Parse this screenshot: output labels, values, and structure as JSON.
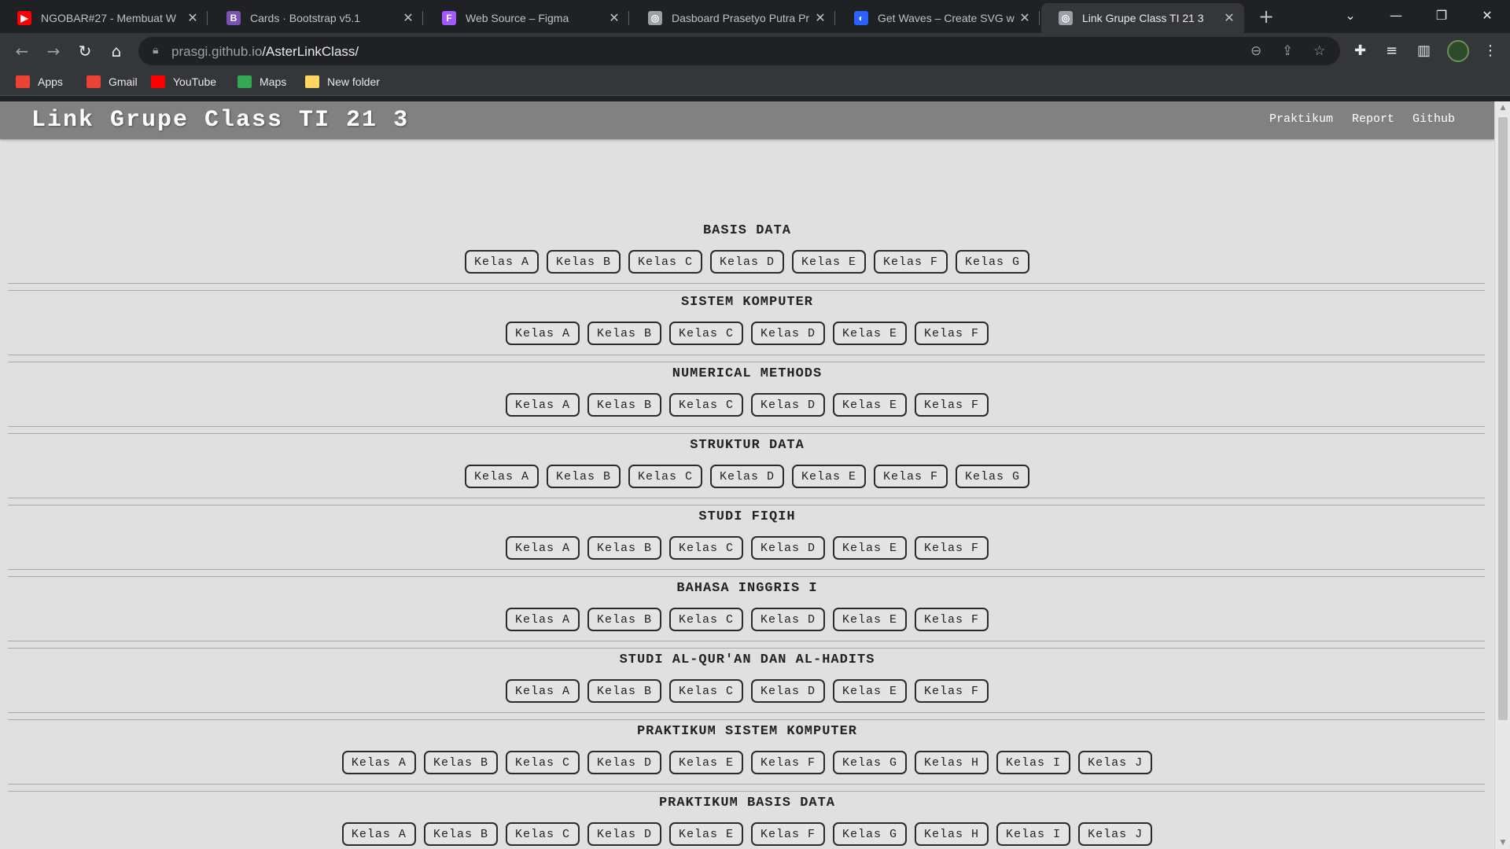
{
  "browser": {
    "tabs": [
      {
        "title": "NGOBAR#27 - Membuat W",
        "favicon": "youtube-icon",
        "color": "#ff0000",
        "glyph": "▶",
        "active": false
      },
      {
        "title": "Cards · Bootstrap v5.1",
        "favicon": "bootstrap-icon",
        "color": "#7952b3",
        "glyph": "B",
        "active": false
      },
      {
        "title": "Web Source – Figma",
        "favicon": "figma-icon",
        "color": "#a259ff",
        "glyph": "F",
        "active": false
      },
      {
        "title": "Dasboard Prasetyo Putra Pr",
        "favicon": "globe-icon",
        "color": "#9aa0a6",
        "glyph": "◎",
        "active": false
      },
      {
        "title": "Get Waves – Create SVG w",
        "favicon": "waves-icon",
        "color": "#2962ff",
        "glyph": "◐",
        "active": false
      },
      {
        "title": "Link Grupe Class TI 21 3",
        "favicon": "globe-icon",
        "color": "#9aa0a6",
        "glyph": "◎",
        "active": true
      }
    ],
    "url_host": "prasgi.github.io",
    "url_path": "/AsterLinkClass/",
    "bookmarks": [
      {
        "label": "Apps",
        "icon": "apps-grid-icon",
        "color": "#ea4335"
      },
      {
        "label": "Gmail",
        "icon": "gmail-icon",
        "color": "#ea4335"
      },
      {
        "label": "YouTube",
        "icon": "youtube-icon",
        "color": "#ff0000"
      },
      {
        "label": "Maps",
        "icon": "maps-icon",
        "color": "#34a853"
      },
      {
        "label": "New folder",
        "icon": "folder-icon",
        "color": "#fdd663"
      }
    ]
  },
  "site": {
    "brand": "Link Grupe Class TI 21 3",
    "nav": [
      "Praktikum",
      "Report",
      "Github"
    ],
    "sections": [
      {
        "title": "BASIS DATA",
        "classes": [
          "Kelas A",
          "Kelas B",
          "Kelas C",
          "Kelas D",
          "Kelas E",
          "Kelas F",
          "Kelas G"
        ]
      },
      {
        "title": "SISTEM KOMPUTER",
        "classes": [
          "Kelas A",
          "Kelas B",
          "Kelas C",
          "Kelas D",
          "Kelas E",
          "Kelas F"
        ]
      },
      {
        "title": "NUMERICAL METHODS",
        "classes": [
          "Kelas A",
          "Kelas B",
          "Kelas C",
          "Kelas D",
          "Kelas E",
          "Kelas F"
        ]
      },
      {
        "title": "STRUKTUR DATA",
        "classes": [
          "Kelas A",
          "Kelas B",
          "Kelas C",
          "Kelas D",
          "Kelas E",
          "Kelas F",
          "Kelas G"
        ]
      },
      {
        "title": "STUDI FIQIH",
        "classes": [
          "Kelas A",
          "Kelas B",
          "Kelas C",
          "Kelas D",
          "Kelas E",
          "Kelas F"
        ]
      },
      {
        "title": "BAHASA INGGRIS I",
        "classes": [
          "Kelas A",
          "Kelas B",
          "Kelas C",
          "Kelas D",
          "Kelas E",
          "Kelas F"
        ]
      },
      {
        "title": "STUDI AL-QUR'AN DAN AL-HADITS",
        "classes": [
          "Kelas A",
          "Kelas B",
          "Kelas C",
          "Kelas D",
          "Kelas E",
          "Kelas F"
        ]
      },
      {
        "title": "PRAKTIKUM SISTEM KOMPUTER",
        "classes": [
          "Kelas A",
          "Kelas B",
          "Kelas C",
          "Kelas D",
          "Kelas E",
          "Kelas F",
          "Kelas G",
          "Kelas H",
          "Kelas I",
          "Kelas J"
        ]
      },
      {
        "title": "PRAKTIKUM BASIS DATA",
        "classes": [
          "Kelas A",
          "Kelas B",
          "Kelas C",
          "Kelas D",
          "Kelas E",
          "Kelas F",
          "Kelas G",
          "Kelas H",
          "Kelas I",
          "Kelas J"
        ]
      }
    ]
  }
}
